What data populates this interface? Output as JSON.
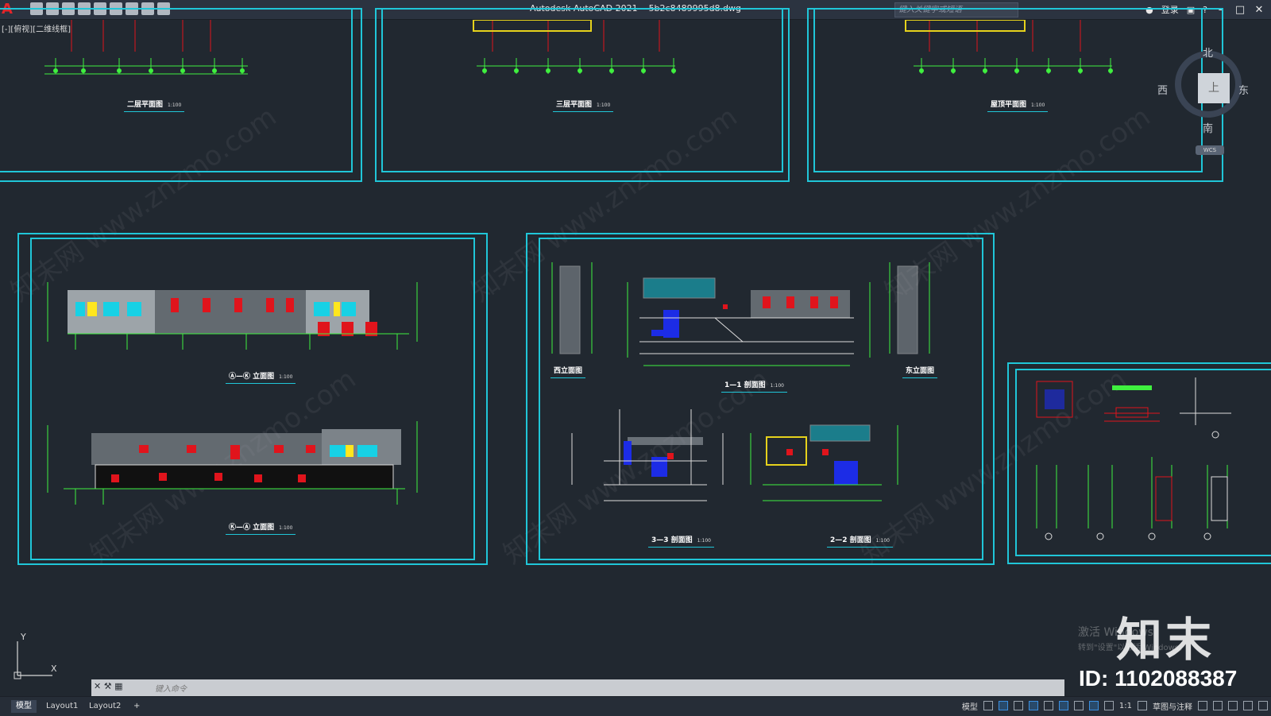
{
  "app": {
    "title": "Autodesk AutoCAD 2021",
    "file": "5b2c8489995d8.dwg",
    "search_placeholder": "键入关键字或短语",
    "login": "登录",
    "viewport_label": "[-][俯视][二维线框]"
  },
  "viewcube": {
    "north": "北",
    "south": "南",
    "east": "东",
    "west": "西",
    "face": "上",
    "wcs": "WCS"
  },
  "drawings": {
    "plan2_title": "二层平面图",
    "plan2_scale": "1:100",
    "plan3_title": "三层平面图",
    "plan3_scale": "1:100",
    "roof_title": "屋顶平面图",
    "roof_scale": "1:100",
    "elev_ak_title": "Ⓐ—Ⓚ 立面图",
    "elev_ak_scale": "1:100",
    "elev_ka_title": "Ⓚ—Ⓐ 立面图",
    "elev_ka_scale": "1:100",
    "west_elev": "西立面图",
    "east_elev": "东立面图",
    "sec11_title": "1—1 剖面图",
    "sec11_scale": "1:100",
    "sec33_title": "3—3 剖面图",
    "sec33_scale": "1:100",
    "sec22_title": "2—2 剖面图",
    "sec22_scale": "1:100"
  },
  "command": {
    "placeholder": "键入命令"
  },
  "tabs": [
    {
      "label": "模型"
    },
    {
      "label": "Layout1"
    },
    {
      "label": "Layout2"
    },
    {
      "label": "+"
    }
  ],
  "status": {
    "model": "模型",
    "scale": "1:1",
    "workspace": "草图与注释"
  },
  "watermark_text": "知末网 www.znzmo.com",
  "overlay": {
    "activate_line1": "激活 Windows",
    "activate_line2": "转到\"设置\"以激活 Windows。",
    "brand": "知末",
    "id": "ID: 1102088387"
  },
  "colors": {
    "frame": "#20c6d8",
    "background": "#212830",
    "dim": "#3ff03f"
  }
}
